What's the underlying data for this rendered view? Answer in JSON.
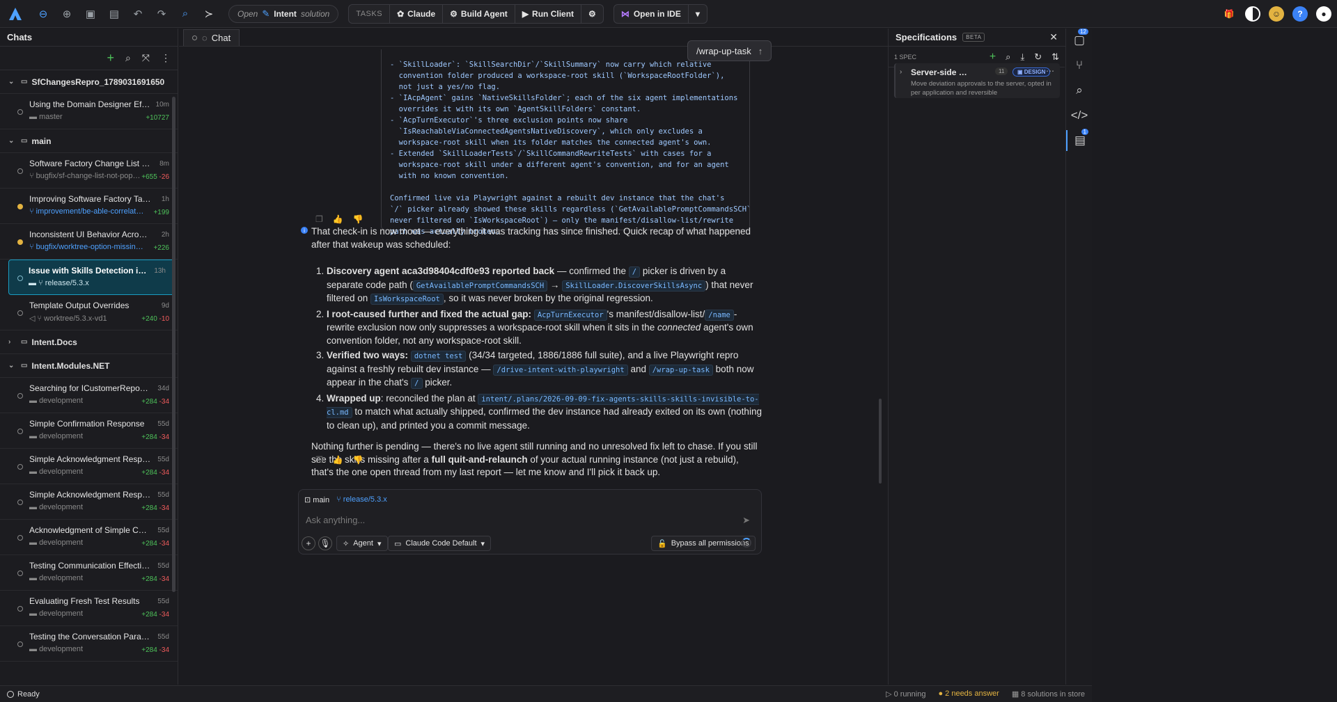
{
  "topbar": {
    "open_label": "Open",
    "solution_name": "Intent",
    "solution_suffix": "solution",
    "tasks_label": "TASKS",
    "claude_label": "Claude",
    "build_agent_label": "Build Agent",
    "run_client_label": "Run Client",
    "open_ide_label": "Open in IDE"
  },
  "sidebar": {
    "title": "Chats",
    "groups": [
      {
        "name": "SfChangesRepro_1789031691650"
      },
      {
        "name": "main"
      },
      {
        "name": "Intent.Docs"
      },
      {
        "name": "Intent.Modules.NET"
      }
    ],
    "chats": [
      {
        "title": "Using the Domain Designer Effectively",
        "time": "10m",
        "branch": "master",
        "add": "+10727",
        "del": ""
      },
      {
        "title": "Software Factory Change List Issues",
        "time": "8m",
        "branch": "bugfix/sf-change-list-not-populating",
        "add": "+655",
        "del": "-26"
      },
      {
        "title": "Improving Software Factory Task Navi...",
        "time": "1h",
        "branch": "improvement/be-able-correlate-sf-to-...",
        "add": "+199",
        "del": ""
      },
      {
        "title": "Inconsistent UI Behavior Across Model...",
        "time": "2h",
        "branch": "bugfix/worktree-option-missing-for-n...",
        "add": "+226",
        "del": ""
      },
      {
        "title": "Issue with Skills Detection in Latest B...",
        "time": "13h",
        "branch": "release/5.3.x",
        "add": "",
        "del": ""
      },
      {
        "title": "Template Output Overrides",
        "time": "9d",
        "branch": "worktree/5.3.x-vd1",
        "add": "+240",
        "del": "-10"
      },
      {
        "title": "Searching for ICustomerRepository M...",
        "time": "34d",
        "branch": "development",
        "add": "+284",
        "del": "-34"
      },
      {
        "title": "Simple Confirmation Response",
        "time": "55d",
        "branch": "development",
        "add": "+284",
        "del": "-34"
      },
      {
        "title": "Simple Acknowledgment Response",
        "time": "55d",
        "branch": "development",
        "add": "+284",
        "del": "-34"
      },
      {
        "title": "Simple Acknowledgment Response",
        "time": "55d",
        "branch": "development",
        "add": "+284",
        "del": "-34"
      },
      {
        "title": "Acknowledgment of Simple Communi...",
        "time": "55d",
        "branch": "development",
        "add": "+284",
        "del": "-34"
      },
      {
        "title": "Testing Communication Effectiveness",
        "time": "55d",
        "branch": "development",
        "add": "+284",
        "del": "-34"
      },
      {
        "title": "Evaluating Fresh Test Results",
        "time": "55d",
        "branch": "development",
        "add": "+284",
        "del": "-34"
      },
      {
        "title": "Testing the Conversation Parameters",
        "time": "55d",
        "branch": "development",
        "add": "+284",
        "del": "-34"
      }
    ]
  },
  "main": {
    "tab_label": "Chat",
    "code_block": "- `SkillLoader`: `SkillSearchDir`/`SkillSummary` now carry which relative\n  convention folder produced a workspace-root skill (`WorkspaceRootFolder`),\n  not just a yes/no flag.\n- `IAcpAgent` gains `NativeSkillsFolder`; each of the six agent implementations\n  overrides it with its own `AgentSkillFolders` constant.\n- `AcpTurnExecutor`'s three exclusion points now share\n  `IsReachableViaConnectedAgentsNativeDiscovery`, which only excludes a\n  workspace-root skill when its folder matches the connected agent's own.\n- Extended `SkillLoaderTests`/`SkillCommandRewriteTests` with cases for a\n  workspace-root skill under a different agent's convention, and for an agent\n  with no known convention.\n\nConfirmed live via Playwright against a rebuilt dev instance that the chat's\n`/` picker already showed these skills regardless (`GetAvailablePromptCommandsSCH`\nnever filtered on `IsWorkspaceRoot`) — only the manifest/disallow-list/rewrite\npath was actually broken.",
    "wrap_pill": "/wrap-up-task",
    "intro": "That check-in is now moot — everything it was tracking has since finished. Quick recap of what happened after that wakeup was scheduled:",
    "item1": {
      "b": "Discovery agent aca3d98404cdf0e93 reported back",
      "t1": " — confirmed the ",
      "c1": "/",
      "t2": " picker is driven by a separate code path (",
      "c2": "GetAvailablePromptCommandsSCH",
      "t3": " → ",
      "c3": "SkillLoader.DiscoverSkillsAsync",
      "t4": ") that never filtered on ",
      "c4": "IsWorkspaceRoot",
      "t5": ", so it was never broken by the original regression."
    },
    "item2": {
      "b": "I root-caused further and fixed the actual gap:",
      "c1": "AcpTurnExecutor",
      "t1": "'s manifest/disallow-list/",
      "c2": "/name",
      "t2": "-rewrite exclusion now only suppresses a workspace-root skill when it sits in the ",
      "em": "connected",
      "t3": " agent's own convention folder, not any workspace-root skill."
    },
    "item3": {
      "b": "Verified two ways:",
      "c1": "dotnet test",
      "t1": " (34/34 targeted, 1886/1886 full suite), and a live Playwright repro against a freshly rebuilt dev instance — ",
      "c2": "/drive-intent-with-playwright",
      "t2": " and ",
      "c3": "/wrap-up-task",
      "t3": " both now appear in the chat's ",
      "c4": "/",
      "t4": " picker."
    },
    "item4": {
      "b": "Wrapped up",
      "t1": ": reconciled the plan at ",
      "c1": "intent/.plans/2026-09-09-fix-agents-skills-skills-invisible-to-cl.md",
      "t2": " to match what actually shipped, confirmed the dev instance had already exited on its own (nothing to clean up), and printed you a commit message."
    },
    "closing": {
      "t1": "Nothing further is pending — there's no live agent still running and no unresolved fix left to chase. If you still see the skills missing after a ",
      "b": "full quit-and-relaunch",
      "t2": " of your actual running instance (not just a rebuild), that's the one open thread from my last report — let me know and I'll pick it back up."
    }
  },
  "composer": {
    "repo": "main",
    "branch": "release/5.3.x",
    "placeholder": "Ask anything...",
    "mode_label": "Agent",
    "model_label": "Claude Code Default",
    "permissions_label": "Bypass all permissions"
  },
  "specs": {
    "title": "Specifications",
    "beta": "BETA",
    "count": "1 SPEC",
    "card": {
      "title": "Server-side Devia...",
      "num": "11",
      "tag": "DESIGN",
      "desc": "Move deviation approvals to the server, opted in per application and reversible"
    }
  },
  "rail": {
    "badge1": "12",
    "badge2": "1"
  },
  "status": {
    "ready": "Ready",
    "running": "0 running",
    "needs_answer": "2 needs answer",
    "solutions": "8 solutions in store"
  },
  "colors": {
    "accent": "#4ea1ff",
    "added": "#4ec25a",
    "removed": "#f25c5c",
    "warning": "#e3b341",
    "selected": "#0f3b4a"
  }
}
